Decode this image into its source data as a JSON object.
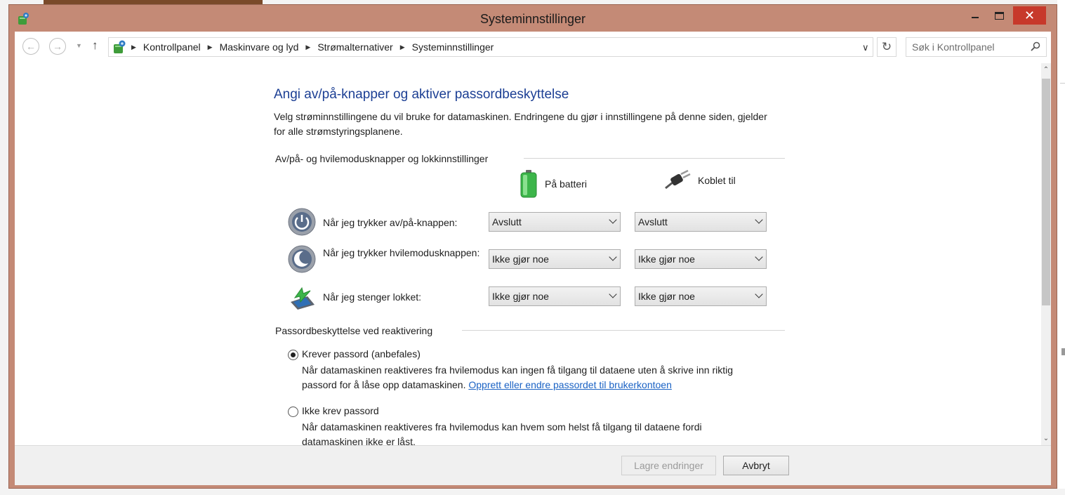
{
  "window": {
    "title": "Systeminnstillinger",
    "close_glyph": "✕"
  },
  "nav": {
    "back_glyph": "←",
    "forward_glyph": "→",
    "recent_glyph": "▼",
    "up_glyph": "↑",
    "breadcrumbs": [
      "Kontrollpanel",
      "Maskinvare og lyd",
      "Strømalternativer",
      "Systeminnstillinger"
    ],
    "crumb_sep": "▶",
    "dropdown_glyph": "∨",
    "refresh_glyph": "↻",
    "search_placeholder": "Søk i Kontrollpanel"
  },
  "page": {
    "heading": "Angi av/på-knapper og aktiver passordbeskyttelse",
    "intro": "Velg strøminnstillingene du vil bruke for datamaskinen. Endringene du gjør i innstillingene på denne siden, gjelder for alle strømstyringsplanene.",
    "buttons_section": "Av/på- og hvilemodusknapper og lokkinnstillinger",
    "col_battery": "På batteri",
    "col_plugged": "Koblet til",
    "rows": [
      {
        "label": "Når jeg trykker av/på-knappen:",
        "battery": "Avslutt",
        "plugged": "Avslutt"
      },
      {
        "label": "Når jeg trykker hvilemodusknappen:",
        "battery": "Ikke gjør noe",
        "plugged": "Ikke gjør noe"
      },
      {
        "label": "Når jeg stenger lokket:",
        "battery": "Ikke gjør noe",
        "plugged": "Ikke gjør noe"
      }
    ],
    "password_section": "Passordbeskyttelse ved reaktivering",
    "opt1_label": "Krever passord (anbefales)",
    "opt1_desc": "Når datamaskinen reaktiveres fra hvilemodus kan ingen få tilgang til dataene uten å skrive inn riktig passord for å låse opp datamaskinen.",
    "opt1_link": "Opprett eller endre passordet til brukerkontoen",
    "opt2_label": "Ikke krev passord",
    "opt2_desc": "Når datamaskinen reaktiveres fra hvilemodus kan hvem som helst få tilgang til dataene fordi datamaskinen ikke er låst.",
    "scroll_up": "⌃",
    "scroll_down": "⌄"
  },
  "footer": {
    "save_label": "Lagre endringer",
    "cancel_label": "Avbryt"
  },
  "colors": {
    "frame": "#c48a76",
    "heading": "#1c3f94",
    "link": "#1a62c4",
    "close": "#c7392b"
  }
}
